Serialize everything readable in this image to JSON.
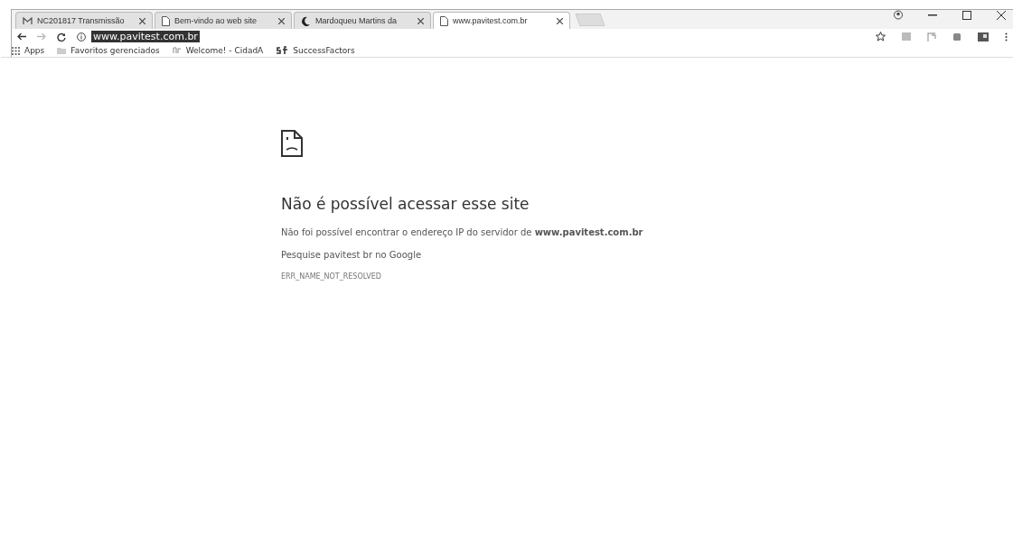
{
  "tabs": [
    {
      "title": "NC201817 Transmissão",
      "kind": "mail",
      "selected": false
    },
    {
      "title": "Bem-vindo ao web site",
      "kind": "page",
      "selected": false
    },
    {
      "title": "Mardoqueu Martins da",
      "kind": "moon",
      "selected": false
    },
    {
      "title": "www.pavitest.com.br",
      "kind": "page",
      "selected": true
    }
  ],
  "address_bar": {
    "value": "www.pavitest.com.br",
    "selected": true
  },
  "bookmarks": [
    {
      "label": "Apps",
      "kind": "apps"
    },
    {
      "label": "Favoritos gerenciados",
      "kind": "folder"
    },
    {
      "label": "Welcome! - CidadA",
      "kind": "sf-small"
    },
    {
      "label": "SuccessFactors",
      "kind": "sf"
    }
  ],
  "error": {
    "title": "Não é possível acessar esse site",
    "description": "Não foi possível encontrar o endereço IP do servidor de **www.pavitest.com.br**",
    "search_hint": "Pesquise pavitest br no Google",
    "code": "ERR_NAME_NOT_RESOLVED"
  }
}
